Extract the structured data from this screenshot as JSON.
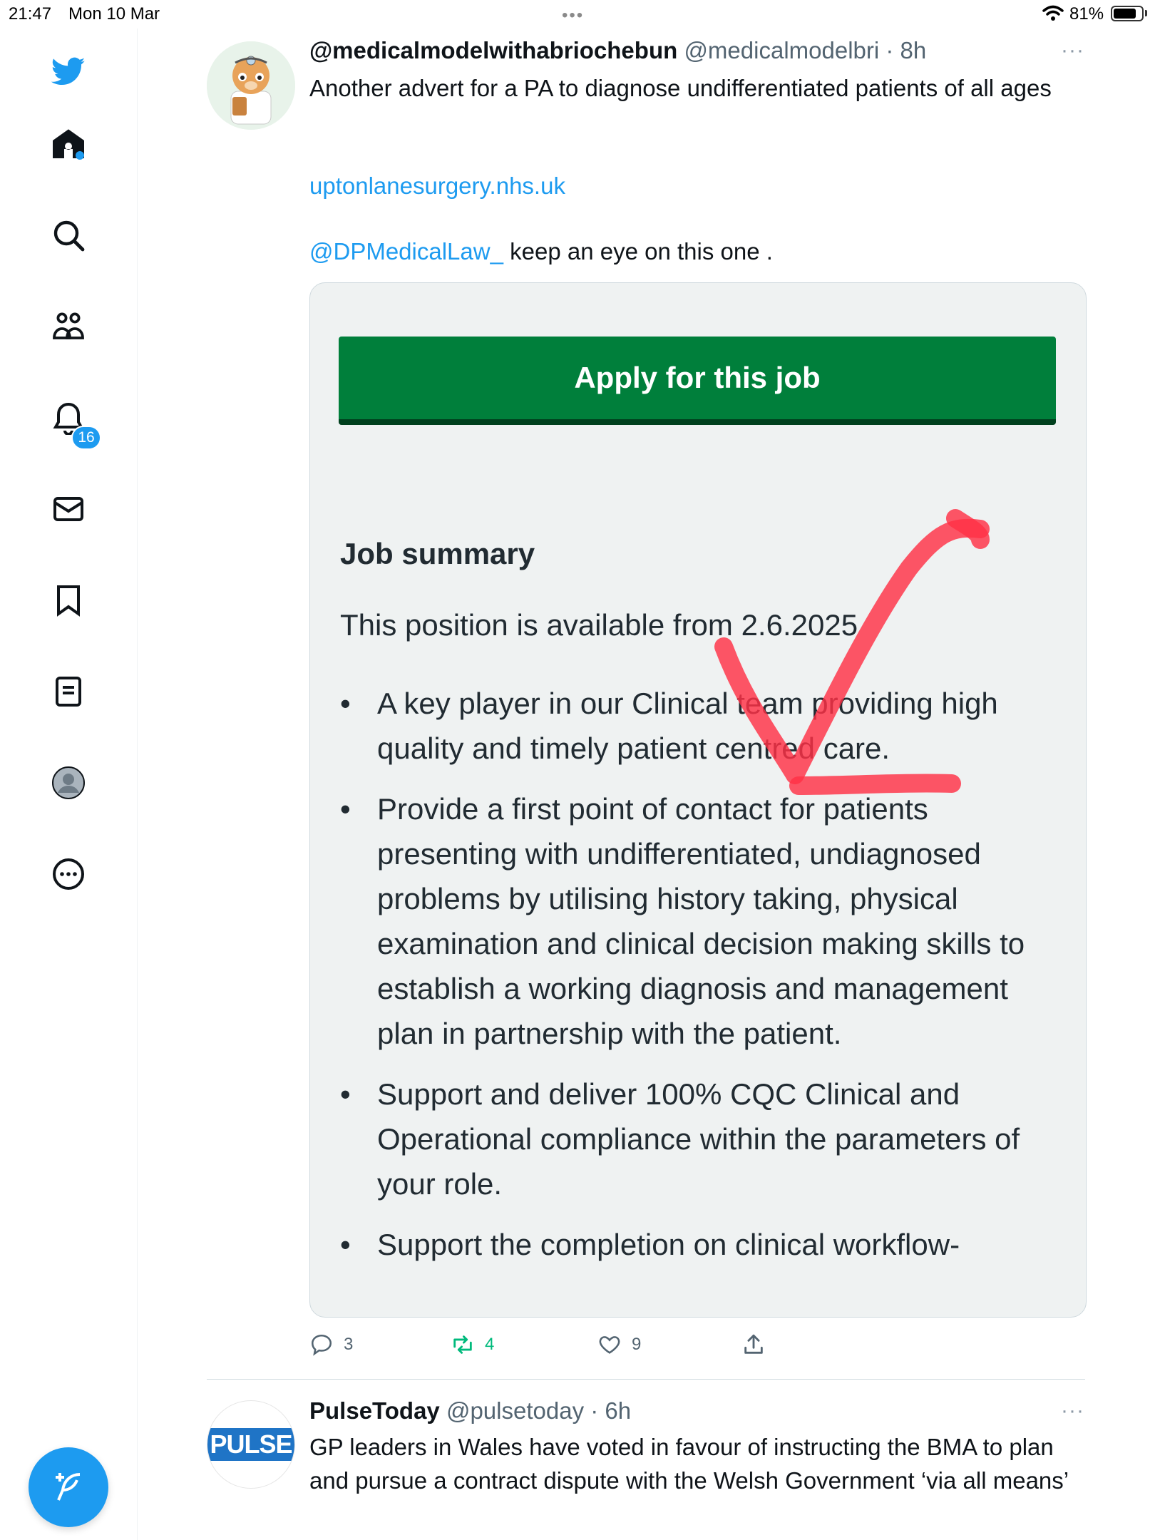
{
  "status_bar": {
    "time": "21:47",
    "date": "Mon 10 Mar",
    "battery": "81%",
    "battery_level": 0.81
  },
  "sidebar": {
    "items": [
      {
        "icon": "twitter-bird-icon"
      },
      {
        "icon": "home-icon"
      },
      {
        "icon": "search-icon"
      },
      {
        "icon": "communities-icon"
      },
      {
        "icon": "notifications-bell-icon"
      },
      {
        "icon": "messages-envelope-icon"
      },
      {
        "icon": "bookmark-icon"
      },
      {
        "icon": "lists-icon"
      },
      {
        "icon": "profile-avatar-icon"
      },
      {
        "icon": "more-circle-icon"
      }
    ],
    "notifications_badge": "16",
    "compose_icon": "compose-feather-icon"
  },
  "colors": {
    "accent": "#1d9bf0",
    "apply_button": "#007f3b",
    "retweet_green": "#00ba7c",
    "tick_red": "#ff3145"
  },
  "tweet1": {
    "display_name": "@medicalmodelwithabriochebun",
    "handle": "@medicalmodelbri",
    "time": "· 8h",
    "text": "Another advert for a PA to diagnose undifferentiated patients of all ages",
    "link": "uptonlanesurgery.nhs.uk",
    "mention": "@DPMedicalLaw_",
    "mention_text": " keep an eye on this one .",
    "media": {
      "apply_button": "Apply for this job",
      "heading": "Job summary",
      "availability": "This position is available from 2.6.2025",
      "bullets": [
        "A key player in our Clinical team providing high quality and timely patient centred care.",
        "Provide a first point of contact for patients presenting with undifferentiated, undiagnosed problems by utilising history taking, physical examination and clinical decision making skills to establish a working diagnosis and management plan in partnership with the patient.",
        "Support and deliver 100% CQC Clinical and Operational compliance within the parameters of your role.",
        "Support the completion on clinical workflow-"
      ]
    },
    "actions": {
      "replies": "3",
      "retweets": "4",
      "likes": "9"
    }
  },
  "tweet2": {
    "display_name": "PulseToday",
    "handle": "@pulsetoday",
    "time": "· 6h",
    "avatar_text": "PULSE",
    "text": "GP leaders in Wales have voted in favour of instructing the BMA to plan and pursue a contract dispute with the Welsh Government ‘via all means’"
  }
}
